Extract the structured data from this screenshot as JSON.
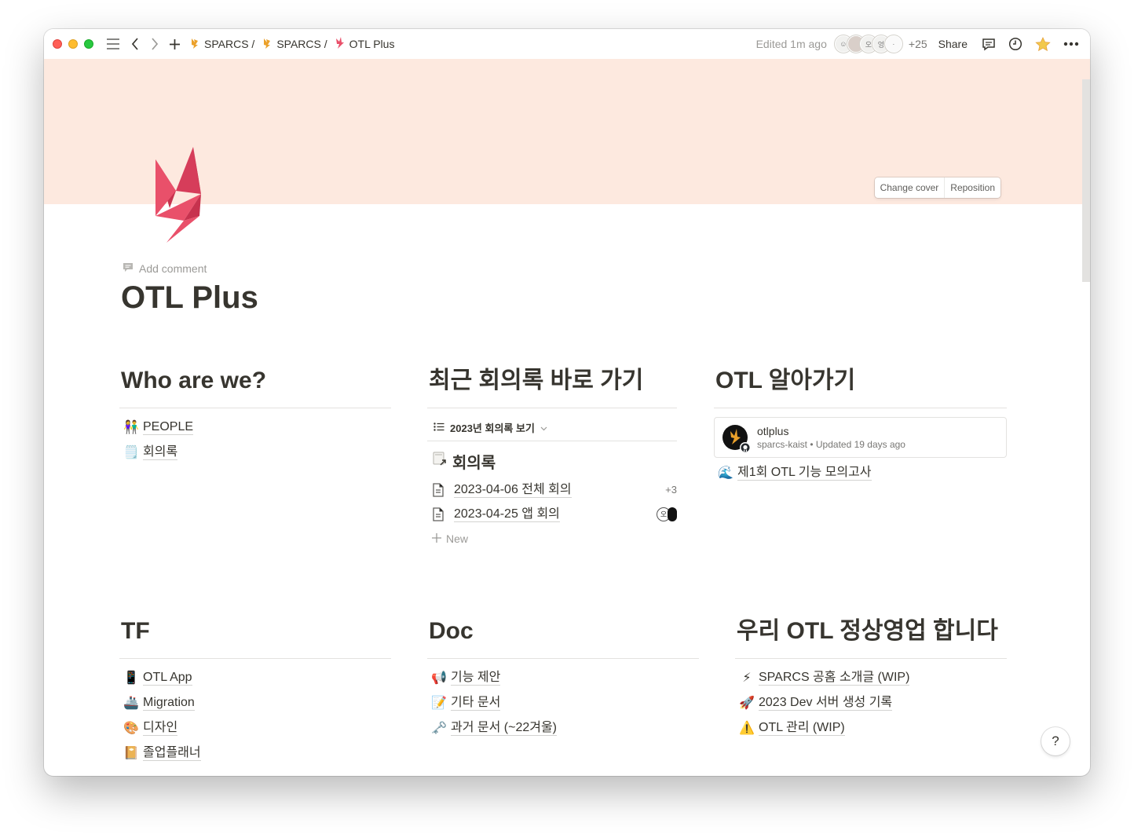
{
  "breadcrumbs": [
    {
      "label": "SPARCS /",
      "icon": "sparcs-logo-icon"
    },
    {
      "label": "SPARCS /",
      "icon": "sparcs-logo-icon"
    },
    {
      "label": "OTL Plus",
      "icon": "otl-logo-icon"
    }
  ],
  "topbar": {
    "edited": "Edited 1m ago",
    "avatar_count": "+25",
    "share_label": "Share",
    "avatar_letters": [
      "오",
      "엉"
    ]
  },
  "cover": {
    "color": "#fde9df",
    "change_label": "Change cover",
    "reposition_label": "Reposition"
  },
  "page": {
    "add_comment": "Add comment",
    "title": "OTL Plus",
    "brand_color": "#e9506a"
  },
  "sections": {
    "who": {
      "heading": "Who are we?",
      "items": [
        {
          "emoji": "👫",
          "label": "PEOPLE"
        },
        {
          "emoji": "🗒️",
          "label": "회의록"
        }
      ]
    },
    "minutes": {
      "heading": "최근 회의록 바로 가기",
      "view_label": "2023년 회의록 보기",
      "db_title": "회의록",
      "rows": [
        {
          "label": "2023-04-06 전체 회의",
          "meta": "+3"
        },
        {
          "label": "2023-04-25 앱 회의",
          "meta": "오"
        }
      ],
      "new_label": "New"
    },
    "learn": {
      "heading": "OTL 알아가기",
      "github": {
        "name": "otlplus",
        "sub": "sparcs-kaist • Updated 19 days ago"
      },
      "items": [
        {
          "emoji": "🌊",
          "label": "제1회 OTL 기능 모의고사"
        }
      ]
    },
    "tf": {
      "heading": "TF",
      "items": [
        {
          "emoji": "📱",
          "label": "OTL App"
        },
        {
          "emoji": "🚢",
          "label": "Migration"
        },
        {
          "emoji": "🎨",
          "label": "디자인"
        },
        {
          "emoji": "📔",
          "label": "졸업플래너"
        }
      ]
    },
    "doc": {
      "heading": "Doc",
      "items": [
        {
          "emoji": "📢",
          "label": "기능 제안"
        },
        {
          "emoji": "📝",
          "label": "기타 문서"
        },
        {
          "emoji": "🗝️",
          "label": "과거 문서 (~22겨울)"
        }
      ]
    },
    "ops": {
      "heading": "우리 OTL 정상영업 합니다",
      "items": [
        {
          "emoji": "⚡",
          "label": "SPARCS 공홈 소개글 (WIP)"
        },
        {
          "emoji": "🚀",
          "label": "2023 Dev 서버 생성 기록"
        },
        {
          "emoji": "⚠️",
          "label": "OTL 관리 (WIP)"
        }
      ]
    }
  },
  "help_label": "?"
}
